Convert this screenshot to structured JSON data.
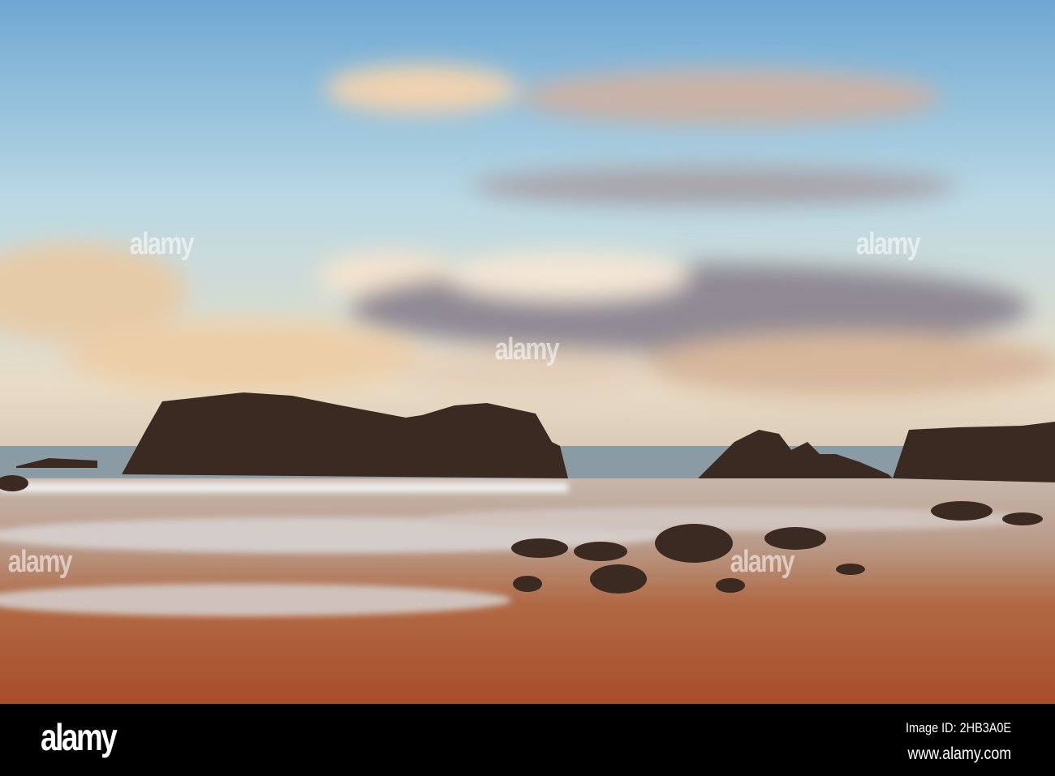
{
  "photo": {
    "subject": "Coastal beach with sea stacks at sunset",
    "colors": {
      "sky_top": "#7fb3d6",
      "sky_low": "#d8e6e0",
      "cloud": "#e8c9a6",
      "rock": "#3a2a22",
      "sand": "#b8643a",
      "water": "#c9c3c0"
    }
  },
  "watermark": {
    "text": "alamy"
  },
  "footer": {
    "logo": "alamy",
    "image_id": "Image ID: 2HB3A0E",
    "url": "www.alamy.com"
  }
}
